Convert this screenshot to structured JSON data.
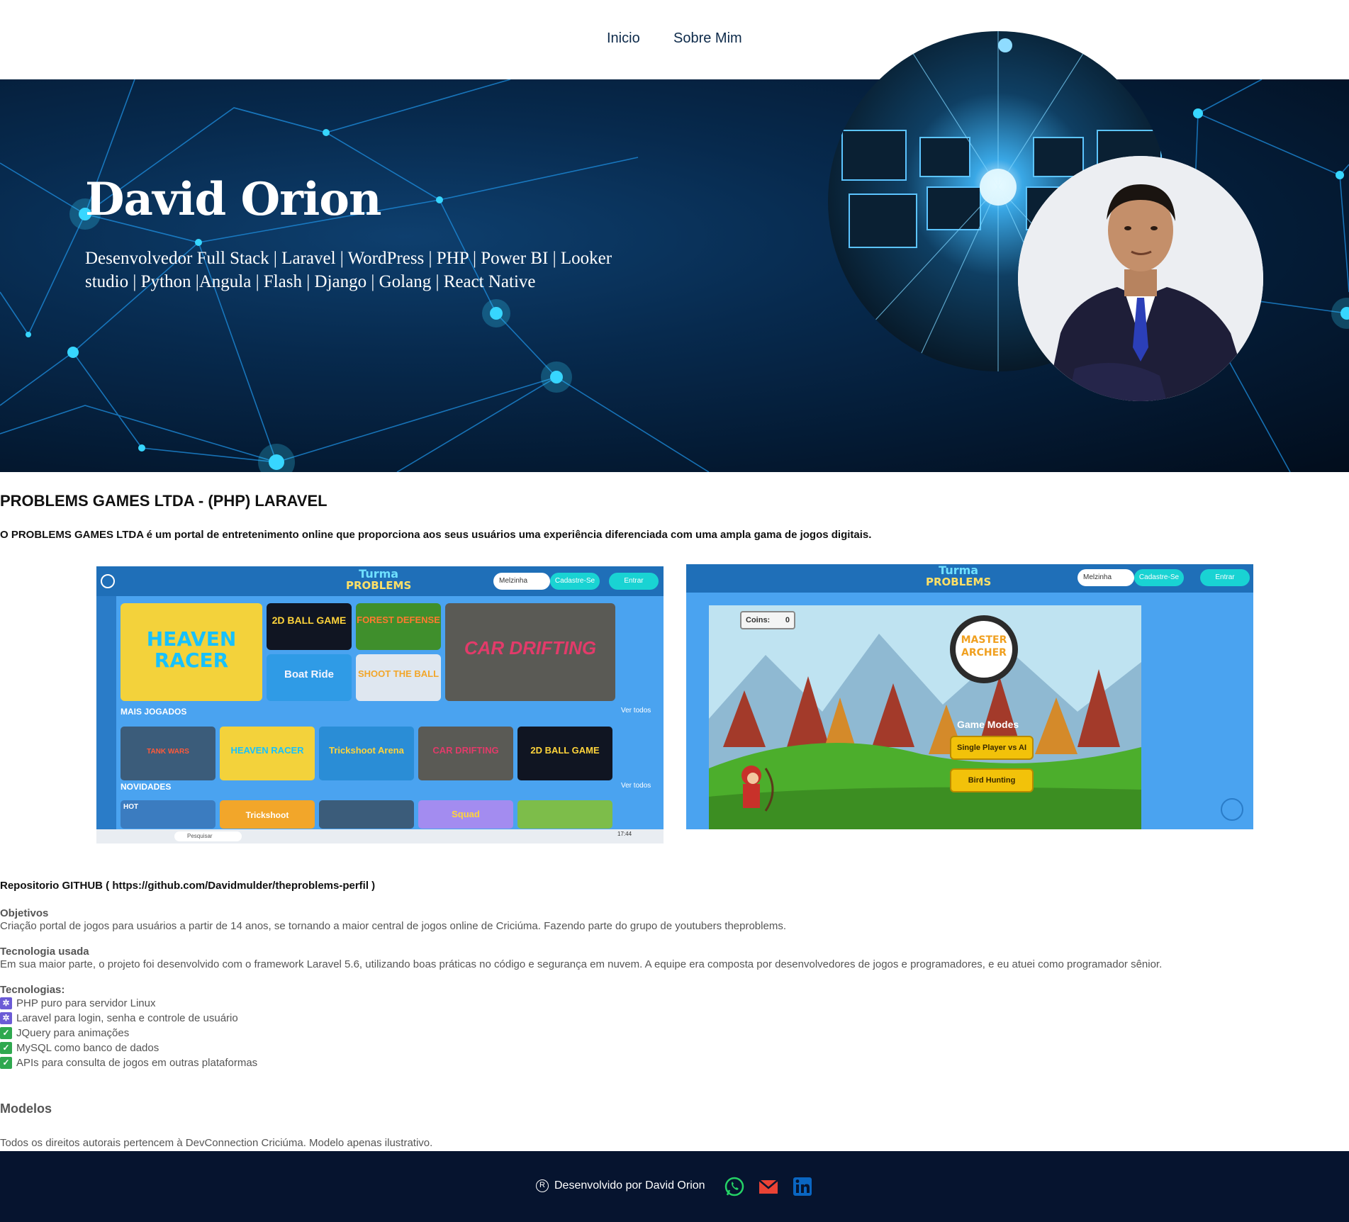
{
  "nav": {
    "home_label": "Inicio",
    "about_label": "Sobre Mim"
  },
  "hero": {
    "name": "David Orion",
    "subtitle": "Desenvolvedor Full Stack | Laravel | WordPress | PHP | Power BI | Looker studio | Python |Angula | Flash | Django | Golang | React Native"
  },
  "project": {
    "title": "PROBLEMS GAMES LTDA - (PHP) LARAVEL",
    "description": "O PROBLEMS GAMES LTDA é um portal de entretenimento online que proporciona aos seus usuários uma experiência diferenciada com uma ampla gama de jogos digitais.",
    "screenshot1": {
      "logo_line1": "Turma",
      "logo_line2": "PROBLEMS",
      "user": "Melzinha",
      "signup": "Cadastre-Se",
      "login": "Entrar",
      "featured": "HEAVEN RACER",
      "tile1": "2D BALL GAME",
      "tile2": "FOREST DEFENSE",
      "tile3": "Boat Ride",
      "tile4": "SHOOT THE BALL",
      "big_tile": "CAR DRIFTING",
      "section1": "MAIS JOGADOS",
      "section2": "NOVIDADES",
      "see_all": "Ver todos",
      "row1": [
        "TANK WARS",
        "HEAVEN RACER",
        "Trickshoot Arena",
        "CAR DRIFTING",
        "2D BALL GAME"
      ],
      "row2": [
        "HOT",
        "Trickshoot",
        "",
        "Squad",
        ""
      ],
      "taskbar_search": "Pesquisar",
      "taskbar_time": "17:44"
    },
    "screenshot2": {
      "logo_line1": "Turma",
      "logo_line2": "PROBLEMS",
      "user": "Melzinha",
      "signup": "Cadastre-Se",
      "login": "Entrar",
      "coins_label": "Coins:",
      "coins_value": "0",
      "game_title1": "MASTER",
      "game_title2": "ARCHER",
      "modes_label": "Game Modes",
      "mode1": "Single Player vs AI",
      "mode2": "Bird Hunting"
    },
    "repo": "Repositorio GITHUB ( https://github.com/Davidmulder/theproblems-perfil )",
    "objectives_heading": "Objetivos",
    "objectives_text": "Criação portal de jogos para usuários a partir de 14 anos, se tornando a maior central de jogos online de Criciúma. Fazendo parte do grupo de youtubers theproblems.",
    "tech_heading": "Tecnologia usada",
    "tech_text": "Em sua maior parte, o projeto foi desenvolvido com o framework Laravel 5.6, utilizando boas práticas no código e segurança em nuvem. A equipe era composta por desenvolvedores de jogos e programadores, e eu atuei como programador sênior.",
    "techs_heading": "Tecnologias:",
    "techs": [
      {
        "icon": "atom-icon",
        "label": "PHP puro para servidor Linux"
      },
      {
        "icon": "atom-icon",
        "label": "Laravel para login, senha e controle de usuário"
      },
      {
        "icon": "check-icon",
        "label": "JQuery para animações"
      },
      {
        "icon": "check-icon",
        "label": "MySQL como banco de dados"
      },
      {
        "icon": "check-icon",
        "label": "APIs para consulta de jogos em outras plataformas"
      }
    ],
    "models_heading": "Modelos",
    "rights": "Todos os direitos autorais pertencem à DevConnection Criciúma. Modelo apenas ilustrativo."
  },
  "footer": {
    "credit": "Desenvolvido por David Orion",
    "registered_symbol": "R",
    "icons": [
      "whatsapp-icon",
      "email-icon",
      "linkedin-icon"
    ]
  },
  "colors": {
    "footer_bg": "#06142f",
    "hero_bg": "#072a4e",
    "nav_text": "#0d2a4a",
    "game_blue": "#4aa3f0"
  }
}
